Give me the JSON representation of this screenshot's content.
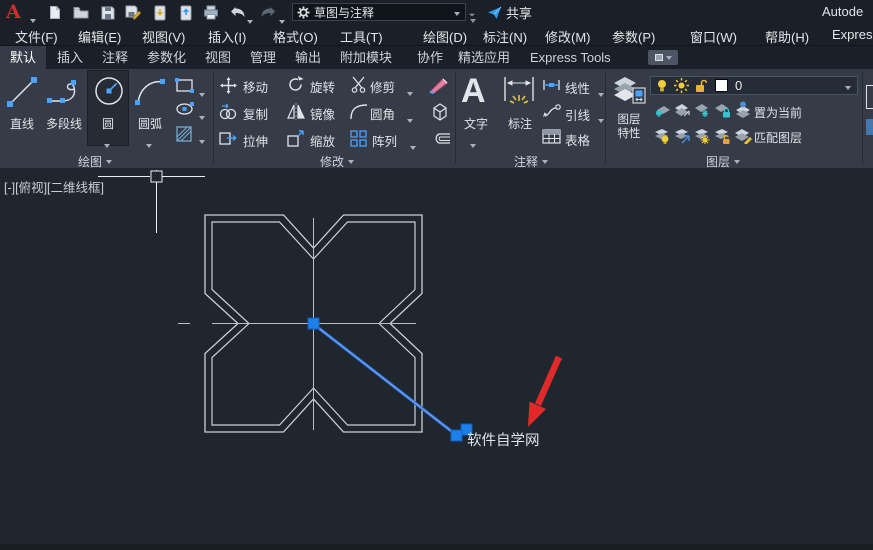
{
  "window": {
    "title_fragment": "Autode"
  },
  "qat": {
    "workspace": "草图与注释",
    "share_label": "共享"
  },
  "menubar": {
    "items": [
      "文件(F)",
      "编辑(E)",
      "视图(V)",
      "插入(I)",
      "格式(O)",
      "工具(T)",
      "绘图(D)",
      "标注(N)",
      "修改(M)",
      "参数(P)",
      "窗口(W)",
      "帮助(H)",
      "Express"
    ]
  },
  "ribbon": {
    "tabs": [
      "默认",
      "插入",
      "注释",
      "参数化",
      "视图",
      "管理",
      "输出",
      "附加模块",
      "协作",
      "精选应用",
      "Express Tools"
    ],
    "active_tab": "默认",
    "draw_panel": {
      "label": "绘图",
      "line": "直线",
      "polyline": "多段线",
      "circle": "圆",
      "arc": "圆弧"
    },
    "modify_panel": {
      "label": "修改",
      "move": "移动",
      "rotate": "旋转",
      "trim": "修剪",
      "copy": "复制",
      "mirror": "镜像",
      "fillet": "圆角",
      "stretch": "拉伸",
      "scale": "缩放",
      "array": "阵列"
    },
    "annotate_panel": {
      "label": "注释",
      "text": "文字",
      "dimension": "标注",
      "linear": "线性",
      "leader": "引线",
      "table": "表格"
    },
    "layer_panel": {
      "label": "图层",
      "properties_line1": "图层",
      "properties_line2": "特性",
      "current_layer": "0",
      "set_current": "置为当前",
      "match_layer": "匹配图层"
    }
  },
  "canvas": {
    "viewport_label": "[-][俯视][二维线框]",
    "watermark_text": "软件自学网"
  },
  "colors": {
    "selection_blue": "#2e6fd6",
    "grip_blue": "#1d80e8",
    "arrow_red": "#e02a2a",
    "geometry_white": "#ccd1d6"
  }
}
